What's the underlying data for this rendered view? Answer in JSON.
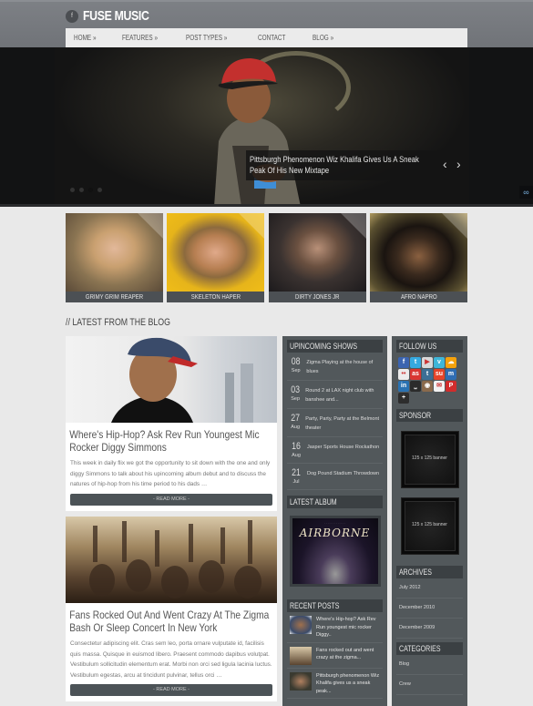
{
  "site": {
    "logo_icon": "f",
    "title": "FUSE MUSIC"
  },
  "nav": [
    {
      "label": "HOME »"
    },
    {
      "label": "FEATURES »"
    },
    {
      "label": "POST TYPES »"
    },
    {
      "label": "CONTACT"
    },
    {
      "label": "BLOG »"
    }
  ],
  "slider": {
    "caption": "Pittsburgh Phenomenon Wiz Khalifa Gives Us A Sneak Peak Of His New Mixtape",
    "prev_icon": "‹",
    "next_icon": "›",
    "slide_count": 4,
    "active_slide": 3,
    "link_icon": "🔗"
  },
  "artists": [
    {
      "name": "GRIMY GRIM REAPER"
    },
    {
      "name": "SKELETON HAPER"
    },
    {
      "name": "DIRTY JONES JR"
    },
    {
      "name": "AFRO NAPRO"
    }
  ],
  "blog": {
    "heading": "// LATEST FROM THE BLOG",
    "posts": [
      {
        "title": "Where's Hip-Hop? Ask Rev Run Youngest Mic Rocker Diggy Simmons",
        "excerpt": "This week in daily flix we got the opportunity to sit down with the one and only diggy Simmons to talk about his upincoming album debut and to discuss the natures of hip-hop from his time period to his dads …",
        "read_more": "- READ MORE -"
      },
      {
        "title": "Fans Rocked Out And Went Crazy At The Zigma Bash Or Sleep Concert In New York",
        "excerpt": "Consectetur adipiscing elit. Cras sem leo, porta ornare vulputate id, facilisis quis massa. Quisque in euismod libero. Praesent commodo dapibus volutpat. Vestibulum sollicitudin elementum erat. Morbi non orci sed ligula lacinia luctus. Vestibulum egestas, arcu at tincidunt pulvinar, tellus orci …",
        "read_more": "- READ MORE -"
      }
    ]
  },
  "shows": {
    "heading": "UPINCOMING SHOWS",
    "items": [
      {
        "day": "08",
        "month": "Sep",
        "text": "Zigma Playing at the house of blues"
      },
      {
        "day": "03",
        "month": "Sep",
        "text": "Round 2 at LAX night club with banshee and..."
      },
      {
        "day": "27",
        "month": "Aug",
        "text": "Party, Party, Party at the Belmont theater"
      },
      {
        "day": "16",
        "month": "Aug",
        "text": "Jasper Sports House Rockathon"
      },
      {
        "day": "21",
        "month": "Jul",
        "text": "Dog Pound Stadium Throwdown"
      }
    ]
  },
  "album": {
    "heading": "LATEST ALBUM",
    "title": "AIRBORNE"
  },
  "recent": {
    "heading": "RECENT POSTS",
    "items": [
      {
        "text": "Where's Hip-hop? Ask Rev Run youngest mic rocker Diggy.."
      },
      {
        "text": "Fans rocked out and went crazy at the zigma..."
      },
      {
        "text": "Pittsburgh phenomenon Wiz Khalifa gives us a sneak peak..."
      }
    ]
  },
  "follow": {
    "heading": "FOLLOW US",
    "icons": [
      {
        "name": "facebook",
        "glyph": "f",
        "color": "#3b64b0"
      },
      {
        "name": "twitter",
        "glyph": "t",
        "color": "#35a9e0"
      },
      {
        "name": "youtube",
        "glyph": "▶",
        "color": "#d9d9d9"
      },
      {
        "name": "vimeo",
        "glyph": "v",
        "color": "#3fb6d8"
      },
      {
        "name": "soundcloud",
        "glyph": "☁",
        "color": "#f5a20c"
      },
      {
        "name": "flickr",
        "glyph": "••",
        "color": "#ececec"
      },
      {
        "name": "lastfm",
        "glyph": "as",
        "color": "#d93532"
      },
      {
        "name": "tumblr",
        "glyph": "t",
        "color": "#3c6f96"
      },
      {
        "name": "stumbleupon",
        "glyph": "su",
        "color": "#e5442a"
      },
      {
        "name": "myspace",
        "glyph": "m",
        "color": "#2f6db3"
      },
      {
        "name": "linkedin",
        "glyph": "in",
        "color": "#2a72b2"
      },
      {
        "name": "digg",
        "glyph": "⎵",
        "color": "#2b2b2b"
      },
      {
        "name": "instagram",
        "glyph": "◉",
        "color": "#8a6a4c"
      },
      {
        "name": "email",
        "glyph": "✉",
        "color": "#f2f2f2"
      },
      {
        "name": "pinterest",
        "glyph": "P",
        "color": "#d22c2c"
      },
      {
        "name": "googleplus",
        "glyph": "+",
        "color": "#2d2d2d"
      }
    ]
  },
  "sponsor": {
    "heading": "SPONSOR",
    "banners": [
      {
        "text": "125 x 125 banner"
      },
      {
        "text": "125 x 125 banner"
      }
    ]
  },
  "archives": {
    "heading": "ARCHIVES",
    "items": [
      {
        "label": "July 2012"
      },
      {
        "label": "December 2010"
      },
      {
        "label": "December 2009"
      }
    ]
  },
  "categories": {
    "heading": "CATEGORIES",
    "items": [
      {
        "label": "Blog"
      },
      {
        "label": "Crew"
      }
    ]
  }
}
